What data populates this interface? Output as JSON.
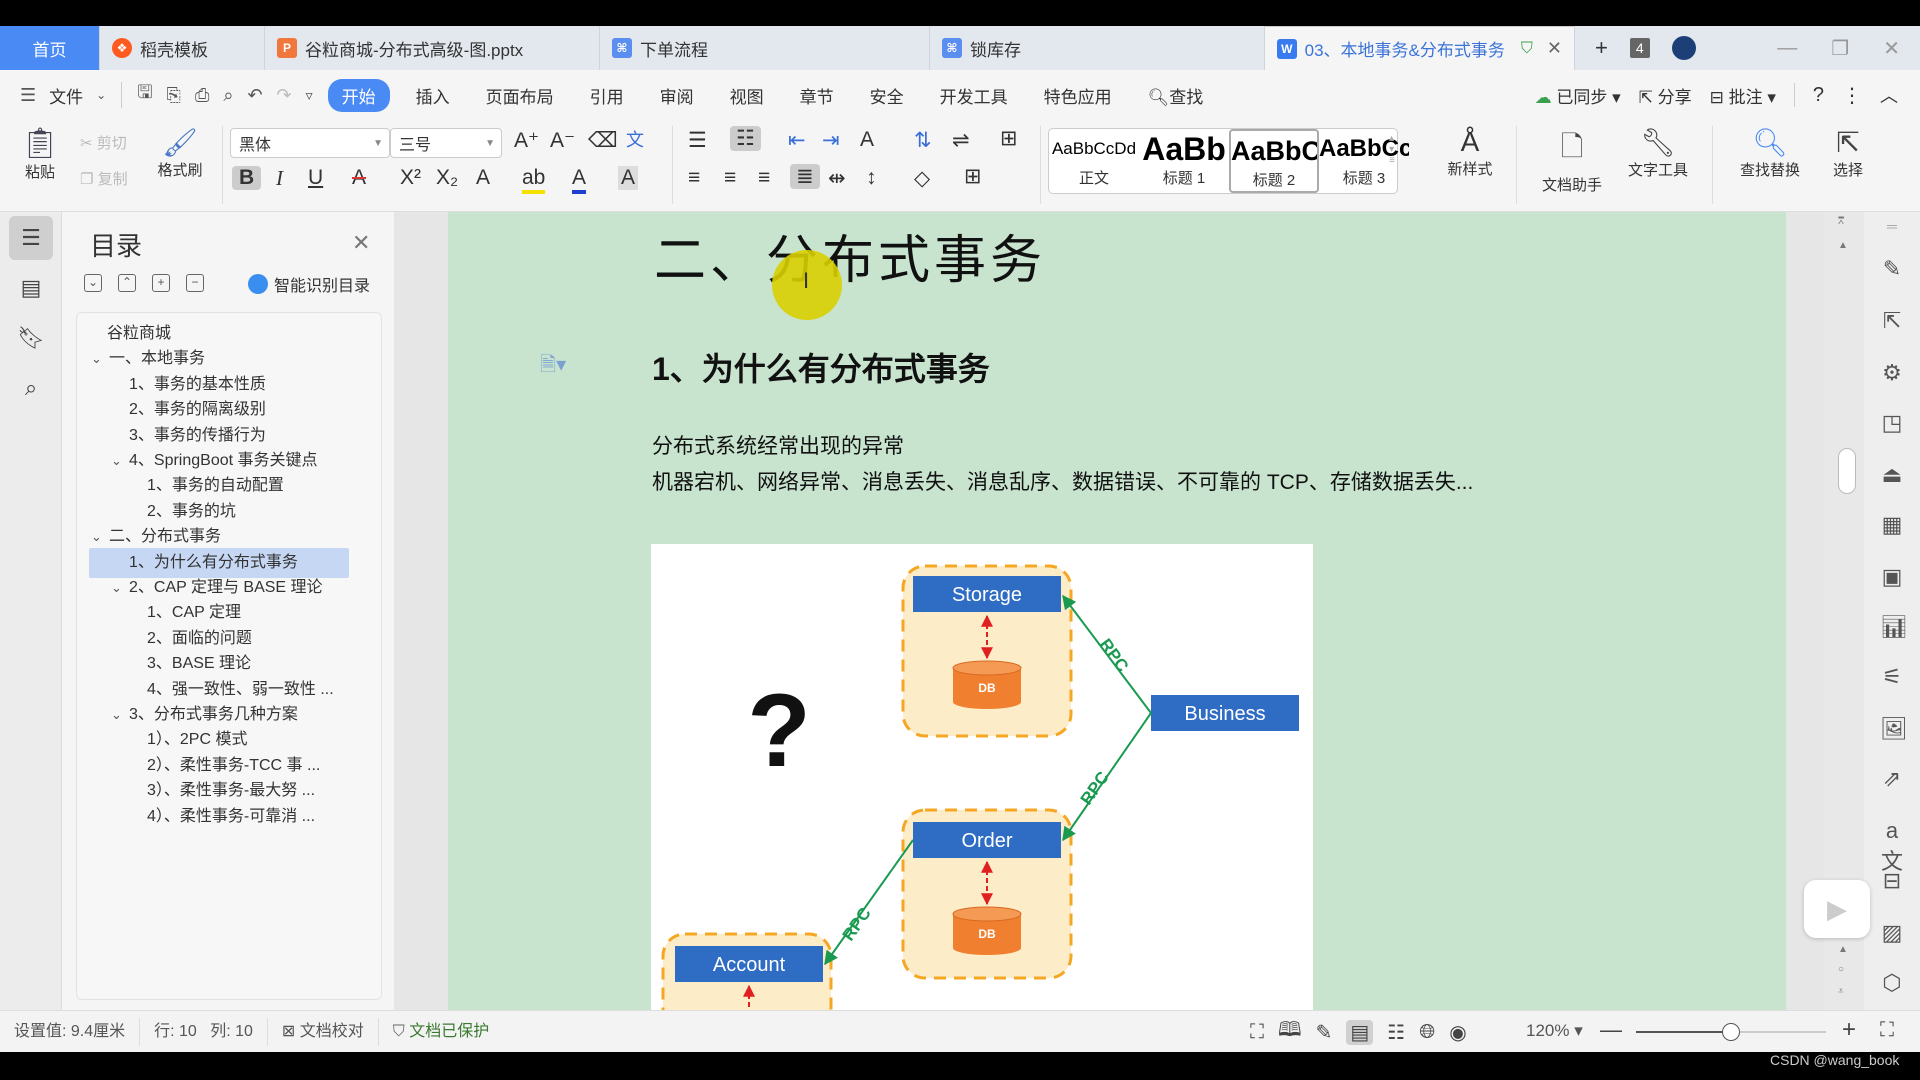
{
  "tabs": [
    {
      "label": "首页",
      "kind": "home"
    },
    {
      "label": "稻壳模板",
      "icon": "docer-icon",
      "icon_color": "#ff5a1f"
    },
    {
      "label": "谷粒商城-分布式高级-图.pptx",
      "icon": "ppt-icon",
      "icon_color": "#f0783c"
    },
    {
      "label": "下单流程",
      "icon": "flowchart-icon",
      "icon_color": "#5a8ef0"
    },
    {
      "label": "锁库存",
      "icon": "flowchart-icon",
      "icon_color": "#5a8ef0"
    },
    {
      "label": "03、本地事务&分布式事务",
      "icon": "word-icon",
      "icon_color": "#3a7af0",
      "active": true
    }
  ],
  "tab_count": "4",
  "menu": {
    "file": "文件",
    "items": [
      "开始",
      "插入",
      "页面布局",
      "引用",
      "审阅",
      "视图",
      "章节",
      "安全",
      "开发工具",
      "特色应用"
    ],
    "active": "开始",
    "search": "查找",
    "synced": "已同步",
    "share": "分享",
    "comment": "批注"
  },
  "ribbon": {
    "paste": "粘贴",
    "cut": "剪切",
    "copy": "复制",
    "format_painter": "格式刷",
    "font": "黑体",
    "font_size": "三号",
    "styles": [
      {
        "preview": "AaBbCcDd",
        "label": "正文"
      },
      {
        "preview": "AaBb",
        "label": "标题 1"
      },
      {
        "preview": "AaBbC",
        "label": "标题 2",
        "selected": true
      },
      {
        "preview": "AaBbCc",
        "label": "标题 3"
      }
    ],
    "new_style": "新样式",
    "doc_assistant": "文档助手",
    "text_tools": "文字工具",
    "find_replace": "查找替换",
    "select": "选择"
  },
  "toc": {
    "title": "目录",
    "smart": "智能识别目录",
    "items": [
      {
        "label": "谷粒商城",
        "level": 0
      },
      {
        "label": "一、本地事务",
        "level": 0,
        "expanded": true
      },
      {
        "label": "1、事务的基本性质",
        "level": 1
      },
      {
        "label": "2、事务的隔离级别",
        "level": 1
      },
      {
        "label": "3、事务的传播行为",
        "level": 1
      },
      {
        "label": "4、SpringBoot 事务关键点",
        "level": 1,
        "expanded": true
      },
      {
        "label": "1、事务的自动配置",
        "level": 2
      },
      {
        "label": "2、事务的坑",
        "level": 2
      },
      {
        "label": "二、分布式事务",
        "level": 0,
        "expanded": true
      },
      {
        "label": "1、为什么有分布式事务",
        "level": 1,
        "selected": true
      },
      {
        "label": "2、CAP 定理与 BASE 理论",
        "level": 1,
        "expanded": true
      },
      {
        "label": "1、CAP 定理",
        "level": 2
      },
      {
        "label": "2、面临的问题",
        "level": 2
      },
      {
        "label": "3、BASE 理论",
        "level": 2
      },
      {
        "label": "4、强一致性、弱一致性 ...",
        "level": 2
      },
      {
        "label": "3、分布式事务几种方案",
        "level": 1,
        "expanded": true
      },
      {
        "label": "1）、2PC 模式",
        "level": 2
      },
      {
        "label": "2）、柔性事务-TCC 事 ...",
        "level": 2
      },
      {
        "label": "3）、柔性事务-最大努 ...",
        "level": 2
      },
      {
        "label": "4）、柔性事务-可靠消 ...",
        "level": 2
      }
    ]
  },
  "doc": {
    "heading1": "二、分布式事务",
    "heading2": "1、为什么有分布式事务",
    "para1": "分布式系统经常出现的异常",
    "para2": "机器宕机、网络异常、消息丢失、消息乱序、数据错误、不可靠的 TCP、存储数据丢失...",
    "figure": {
      "question": "?",
      "nodes": {
        "storage": "Storage",
        "order": "Order",
        "account": "Account",
        "business": "Business",
        "db": "DB"
      },
      "edge_label": "RPC",
      "colors": {
        "node": "#2f6cc4",
        "db": "#f07f2f",
        "group_fill": "#fdecc8",
        "group_border": "#f5a623",
        "edge": "#1a9a50",
        "db_link": "#e02020"
      }
    }
  },
  "status": {
    "setting": "设置值: 9.4厘米",
    "row": "行: 10",
    "col": "列: 10",
    "proofread": "文档校对",
    "protected": "文档已保护",
    "zoom": "120%",
    "zoom_fraction": 0.5
  },
  "watermark": "CSDN @wang_book"
}
